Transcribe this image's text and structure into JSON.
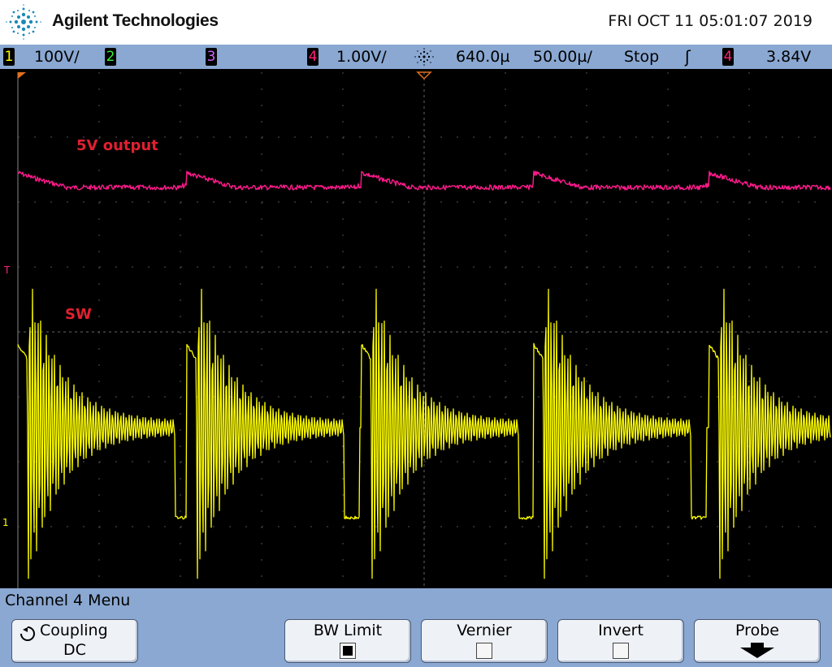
{
  "header": {
    "brand": "Agilent Technologies",
    "datetime": "FRI OCT 11 05:01:07 2019"
  },
  "status_bar": {
    "ch1": {
      "label": "1",
      "scale": "100V/",
      "color": "#ffff00"
    },
    "ch2": {
      "label": "2",
      "color": "#33ee33"
    },
    "ch3": {
      "label": "3",
      "color": "#cc66ff"
    },
    "ch4": {
      "label": "4",
      "scale": "1.00V/",
      "color": "#ff2277"
    },
    "delay": "640.0µ",
    "timebase": "50.00µ/",
    "run_state": "Stop",
    "trigger_symbol": "ʃ",
    "trigger_channel": "4",
    "trigger_level": "3.84V"
  },
  "waveforms": {
    "label_5v": "5V output",
    "label_sw": "SW",
    "label_color": "#e02030",
    "trace_5v_color": "#ff1a8c",
    "trace_sw_color": "#ffff00",
    "trigger_marker": "T",
    "ground_marker": "1"
  },
  "menu": {
    "title": "Channel 4  Menu",
    "coupling": {
      "label": "Coupling",
      "value": "DC"
    },
    "bw_limit": {
      "label": "BW Limit",
      "checked": true
    },
    "vernier": {
      "label": "Vernier",
      "checked": false
    },
    "invert": {
      "label": "Invert",
      "checked": false
    },
    "probe": {
      "label": "Probe"
    }
  }
}
